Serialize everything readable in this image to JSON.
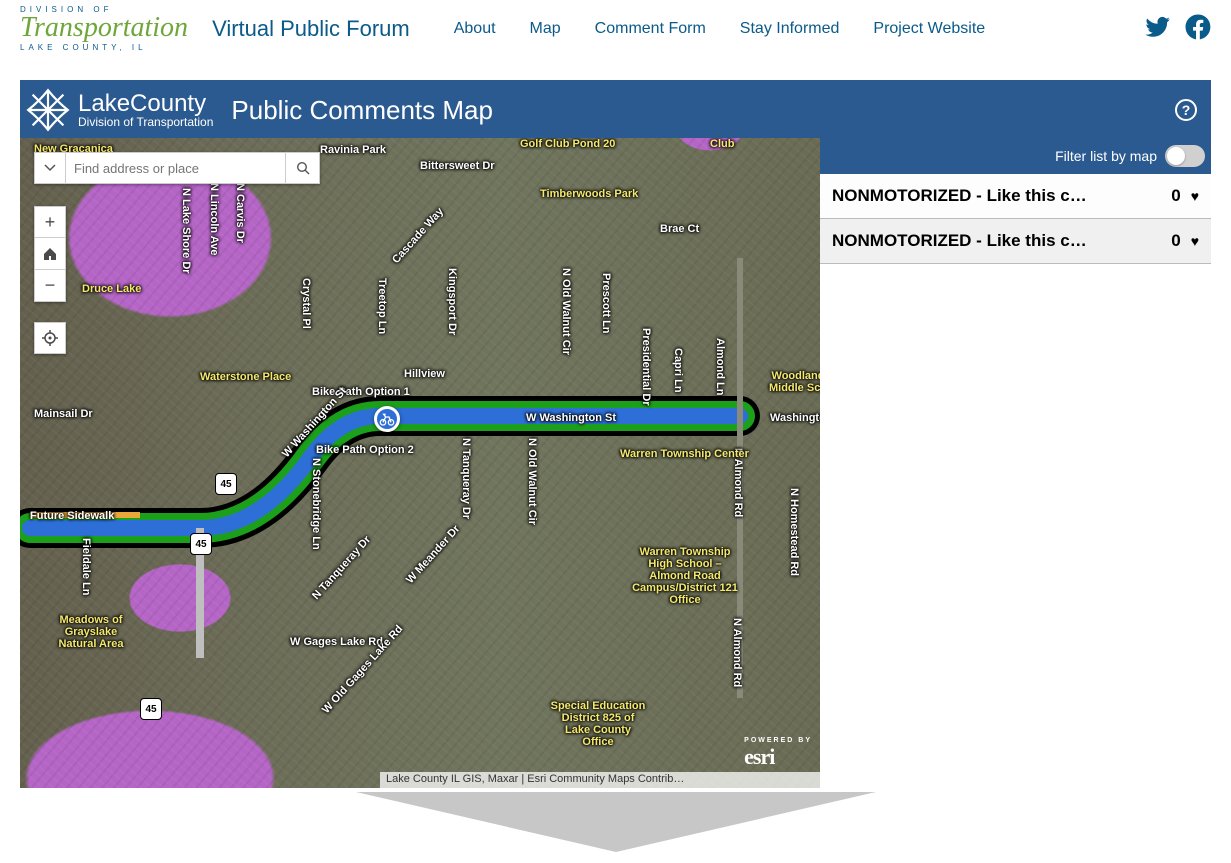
{
  "logo": {
    "prefix": "DIVISION OF",
    "script": "Transportation",
    "suffix": "LAKE COUNTY, IL"
  },
  "forum_title": "Virtual Public Forum",
  "nav": {
    "about": "About",
    "map": "Map",
    "comment_form": "Comment Form",
    "stay_informed": "Stay Informed",
    "project_website": "Project Website"
  },
  "app": {
    "lc_big": "LakeCounty",
    "lc_small": "Division of Transportation",
    "title": "Public Comments Map"
  },
  "search": {
    "placeholder": "Find address or place"
  },
  "filter": {
    "label": "Filter list by map"
  },
  "list": {
    "items": [
      {
        "title": "NONMOTORIZED ‑ Like this c…",
        "count": "0"
      },
      {
        "title": "NONMOTORIZED ‑ Like this c…",
        "count": "0"
      }
    ]
  },
  "map_labels": {
    "new_gracanica": "New Gracanica",
    "ravinia_park": "Ravinia Park",
    "bittersweet": "Bittersweet Dr",
    "golf_club": "Golf Club Pond 20",
    "club": "Club",
    "timberwoods": "Timberwoods Park",
    "brae_ct": "Brae Ct",
    "druce_lake": "Druce Lake",
    "waterstone": "Waterstone Place",
    "mainsail": "Mainsail Dr",
    "bike1": "Bike Path Option 1",
    "bike2": "Bike Path Option 2",
    "wwash": "W Washington St",
    "wwash2": "W Washington St",
    "wash_r": "Washington",
    "future": "Future Sidewalk",
    "almond": "N Almond Rd",
    "homestead": "N Homestead Rd",
    "warren_center": "Warren Township Center",
    "warren_hs": "Warren Township High School – Almond Road Campus/District 121 Office",
    "gages": "W Gages Lake Rd",
    "old_gages": "W Old Gages Lake Rd",
    "woodland": "Woodland Middle Sch",
    "meadows": "Meadows of Grayslake Natural Area",
    "sp_ed": "Special Education District 825 of Lake County Office",
    "cascade": "Cascade Way",
    "treetop": "Treetop Ln",
    "hillview": "Hillview",
    "kingsport": "Kingsport Dr",
    "oldwalnut": "N Old Walnut Cir",
    "oldwalnut2": "N Old Walnut Cir",
    "prescott": "Prescott Ln",
    "presidential": "Presidential Dr",
    "capri": "Capri Ln",
    "almondln": "Almond Ln",
    "lakeshore": "N Lake Shore Dr",
    "lincoln": "N Lincoln Ave",
    "carvis": "N Carvis Dr",
    "crystal": "Crystal Pl",
    "stonebridge": "N Stonebridge Ln",
    "tanqueray": "N Tanqueray Dr",
    "tanqueray2": "N Tanqueray Dr",
    "meander": "W Meander Dr",
    "fieldale": "Fieldale Ln",
    "shield45": "45"
  },
  "attribution": "Lake County IL GIS, Maxar | Esri Community Maps Contrib…",
  "esri": {
    "pre": "POWERED BY",
    "name": "esri"
  }
}
